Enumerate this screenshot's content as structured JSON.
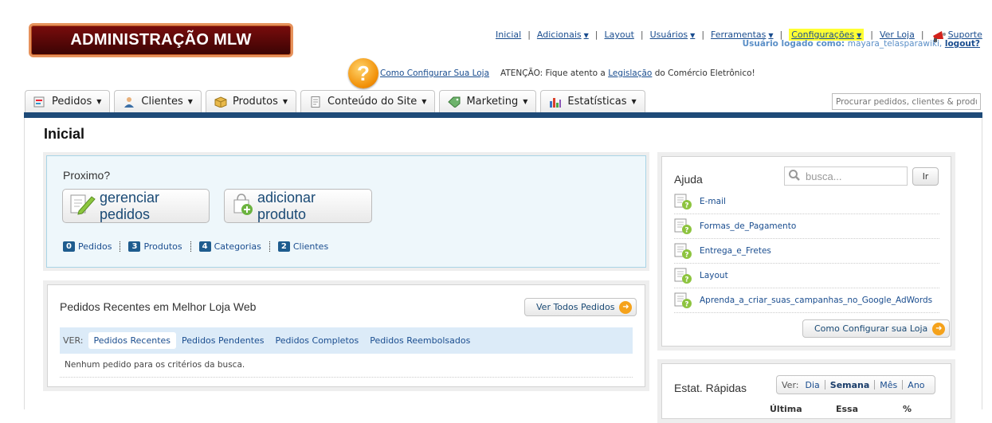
{
  "logo": {
    "text": "ADMINISTRAÇÃO MLW"
  },
  "topmenu": {
    "inicial": "Inicial",
    "adicionais": "Adicionais",
    "layout": "Layout",
    "usuarios": "Usuários",
    "ferramentas": "Ferramentas",
    "configuracoes": "Configurações",
    "ver_loja": "Ver Loja",
    "suporte": "Suporte",
    "separator": "|",
    "highlight_color": "#ffff33"
  },
  "user": {
    "label": "Usuário logado como:",
    "name": "mayara_telasparawiki,",
    "logout": "logout?"
  },
  "helpline": {
    "icon_text": "?",
    "config_link": "Como Configurar Sua Loja",
    "atencao_prefix": "ATENÇÃO: Fique atento a ",
    "atencao_link": "Legislação",
    "atencao_suffix": " do Comércio Eletrônico!"
  },
  "tabs": [
    {
      "label": "Pedidos"
    },
    {
      "label": "Clientes"
    },
    {
      "label": "Produtos"
    },
    {
      "label": "Conteúdo do Site"
    },
    {
      "label": "Marketing"
    },
    {
      "label": "Estatísticas"
    }
  ],
  "search": {
    "placeholder": "Procurar pedidos, clientes & produtos"
  },
  "page": {
    "title": "Inicial"
  },
  "proximo": {
    "title": "Proximo?",
    "btn_gerenciar": "gerenciar pedidos",
    "btn_adicionar": "adicionar produto",
    "stats": [
      {
        "count": "0",
        "label": "Pedidos"
      },
      {
        "count": "3",
        "label": "Produtos"
      },
      {
        "count": "4",
        "label": "Categorias"
      },
      {
        "count": "2",
        "label": "Clientes"
      }
    ]
  },
  "pedidos": {
    "title": "Pedidos Recentes em Melhor Loja Web",
    "ver_todos": "Ver Todos Pedidos",
    "ver_label": "VER:",
    "filters": [
      "Pedidos Recentes",
      "Pedidos Pendentes",
      "Pedidos Completos",
      "Pedidos Reembolsados"
    ],
    "empty": "Nenhum pedido para os critérios da busca."
  },
  "ajuda": {
    "title": "Ajuda",
    "search_placeholder": "busca...",
    "go": "Ir",
    "items": [
      "E-mail",
      "Formas_de_Pagamento",
      "Entrega_e_Fretes",
      "Layout",
      "Aprenda_a_criar_suas_campanhas_no_Google_AdWords"
    ],
    "como_btn": "Como Configurar sua Loja"
  },
  "estat": {
    "title": "Estat. Rápidas",
    "ver_label": "Ver:",
    "periods": [
      "Dia",
      "Semana",
      "Mês",
      "Ano"
    ],
    "columns": [
      "Última",
      "Essa",
      "%"
    ]
  },
  "colors": {
    "nav_bar": "#1e4a78",
    "accent_orange": "#f5a21b",
    "link": "#1a4d8f"
  }
}
